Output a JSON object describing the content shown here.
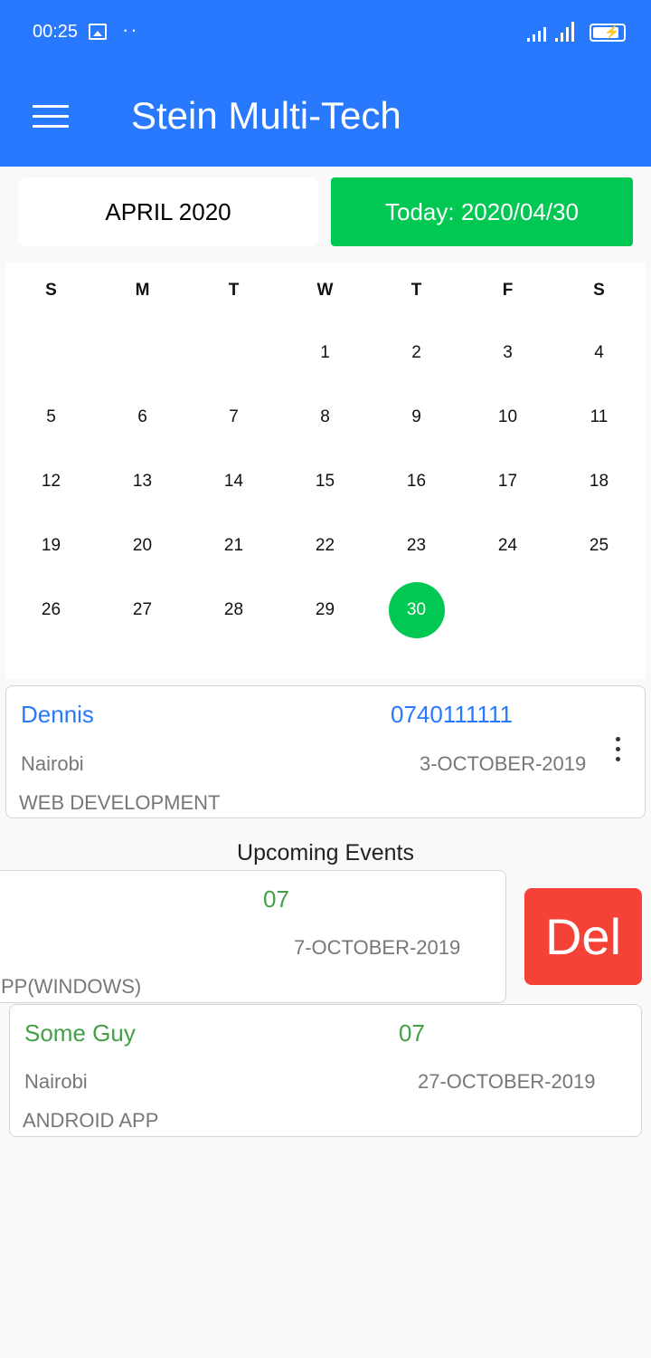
{
  "status_bar": {
    "time": "00:25"
  },
  "app_bar": {
    "title": "Stein Multi-Tech"
  },
  "calendar": {
    "month_label": "APRIL 2020",
    "today_label": "Today: 2020/04/30",
    "weekdays": [
      "S",
      "M",
      "T",
      "W",
      "T",
      "F",
      "S"
    ],
    "days": [
      "1",
      "2",
      "3",
      "4",
      "5",
      "6",
      "7",
      "8",
      "9",
      "10",
      "11",
      "12",
      "13",
      "14",
      "15",
      "16",
      "17",
      "18",
      "19",
      "20",
      "21",
      "22",
      "23",
      "24",
      "25",
      "26",
      "27",
      "28",
      "29",
      "30"
    ],
    "selected_day": "30"
  },
  "client_card": {
    "name": "Dennis",
    "phone": "0740111111",
    "location": "Nairobi",
    "date": "3-OCTOBER-2019",
    "service": "WEB DEVELOPMENT"
  },
  "upcoming": {
    "title": "Upcoming Events",
    "events": [
      {
        "phone": "07",
        "date": "7-OCTOBER-2019",
        "service": "PP(WINDOWS)"
      },
      {
        "name": "Some Guy",
        "phone": "07",
        "location": "Nairobi",
        "date": "27-OCTOBER-2019",
        "service": "ANDROID APP"
      }
    ],
    "delete_label": "Del"
  },
  "colors": {
    "primary": "#2979ff",
    "accent_green": "#00c853",
    "event_green": "#43a047",
    "delete_red": "#f44336"
  }
}
